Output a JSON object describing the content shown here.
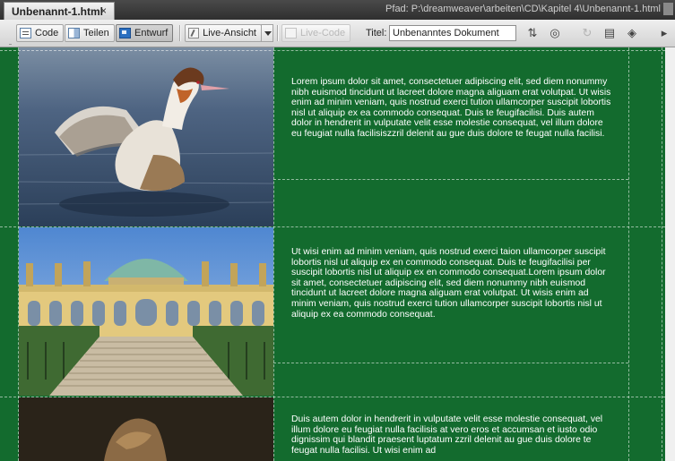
{
  "tab": {
    "filename": "Unbenannt-1.html",
    "close": "×"
  },
  "path_text": "Pfad:  P:\\dreamweaver\\arbeiten\\CD\\Kapitel 4\\Unbenannt-1.html",
  "toolbar": {
    "code_label": "Code",
    "split_label": "Teilen",
    "design_label": "Entwurf",
    "live_view_label": "Live-Ansicht",
    "live_code_label": "Live-Code",
    "title_label": "Titel:",
    "title_value": "Unbenanntes Dokument"
  },
  "icons": {
    "file_management": "file-management-icon",
    "preview": "preview-browser-icon",
    "refresh": "refresh-icon",
    "view_options": "view-options-icon",
    "visual_aids": "visual-aids-icon"
  },
  "content": {
    "paragraph_1": "Lorem ipsum dolor sit amet, consectetuer adipiscing elit, sed diem nonummy nibh euismod tincidunt ut lacreet dolore magna aliguam erat volutpat. Ut wisis enim ad minim veniam, quis nostrud exerci tution ullamcorper suscipit lobortis nisl ut aliquip ex ea commodo consequat. Duis te feugifacilisi. Duis autem dolor in hendrerit in vulputate velit esse molestie consequat, vel illum dolore eu feugiat nulla facilisiszzril delenit au gue duis dolore te feugat nulla facilisi.",
    "paragraph_2": "Ut wisi enim ad minim veniam, quis nostrud exerci taion ullamcorper suscipit lobortis nisl ut aliquip ex en commodo consequat. Duis te feugifacilisi per suscipit lobortis nisl ut aliquip ex en commodo consequat.Lorem ipsum dolor sit amet, consectetuer adipiscing elit, sed diem nonummy nibh euismod tincidunt ut lacreet dolore magna aliguam erat volutpat. Ut wisis enim ad minim veniam, quis nostrud exerci tution ullamcorper suscipit lobortis nisl ut aliquip ex ea commodo consequat.",
    "paragraph_3": "Duis autem dolor in hendrerit in vulputate velit esse molestie consequat, vel illum dolore eu feugiat nulla facilisis at vero eros et accumsan et iusto odio dignissim qui blandit praesent luptatum zzril delenit au gue duis dolore te feugat nulla facilisi. Ut wisi enim ad"
  },
  "colors": {
    "page_background": "#136b2e",
    "text": "#ffffff"
  }
}
